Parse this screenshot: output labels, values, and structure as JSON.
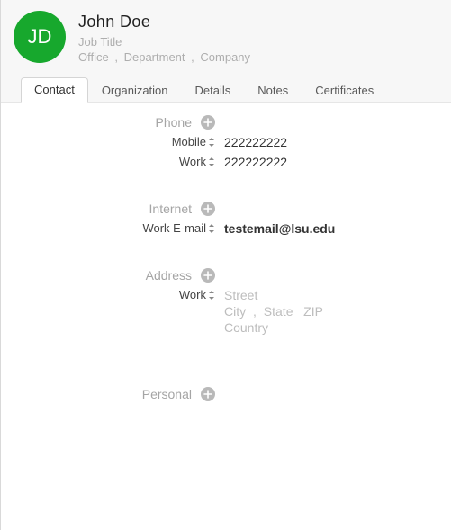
{
  "avatar": {
    "initials": "JD"
  },
  "name": "John  Doe",
  "job_title_placeholder": "Job Title",
  "org": {
    "office": "Office",
    "department": "Department",
    "company": "Company",
    "sep": ","
  },
  "tabs": {
    "contact": "Contact",
    "organization": "Organization",
    "details": "Details",
    "notes": "Notes",
    "certificates": "Certificates"
  },
  "sections": {
    "phone": {
      "label": "Phone",
      "fields": [
        {
          "label": "Mobile",
          "value": "222222222"
        },
        {
          "label": "Work",
          "value": "222222222"
        }
      ]
    },
    "internet": {
      "label": "Internet",
      "fields": [
        {
          "label": "Work E-mail",
          "value": "testemail@lsu.edu"
        }
      ]
    },
    "address": {
      "label": "Address",
      "fields": [
        {
          "label": "Work",
          "street": "Street",
          "city": "City",
          "state": "State",
          "zip": "ZIP",
          "country": "Country",
          "sep": ","
        }
      ]
    },
    "personal": {
      "label": "Personal"
    }
  }
}
